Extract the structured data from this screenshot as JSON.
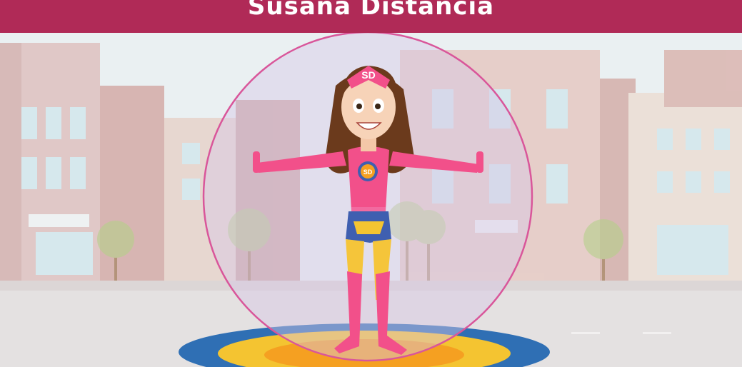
{
  "banner": {
    "title": "Susana Distancia",
    "color": "#b02a57"
  },
  "character": {
    "headband_text": "SD",
    "chest_badge_text": "SD",
    "suit_color": "#f2508a",
    "hair_color": "#6b3a1c",
    "shorts_color": "#3f5fb0",
    "leg_color": "#f5c53a"
  },
  "scene": {
    "description_icons": [
      "buildings-background",
      "trees",
      "protective-bubble",
      "target-ring-floor"
    ]
  }
}
